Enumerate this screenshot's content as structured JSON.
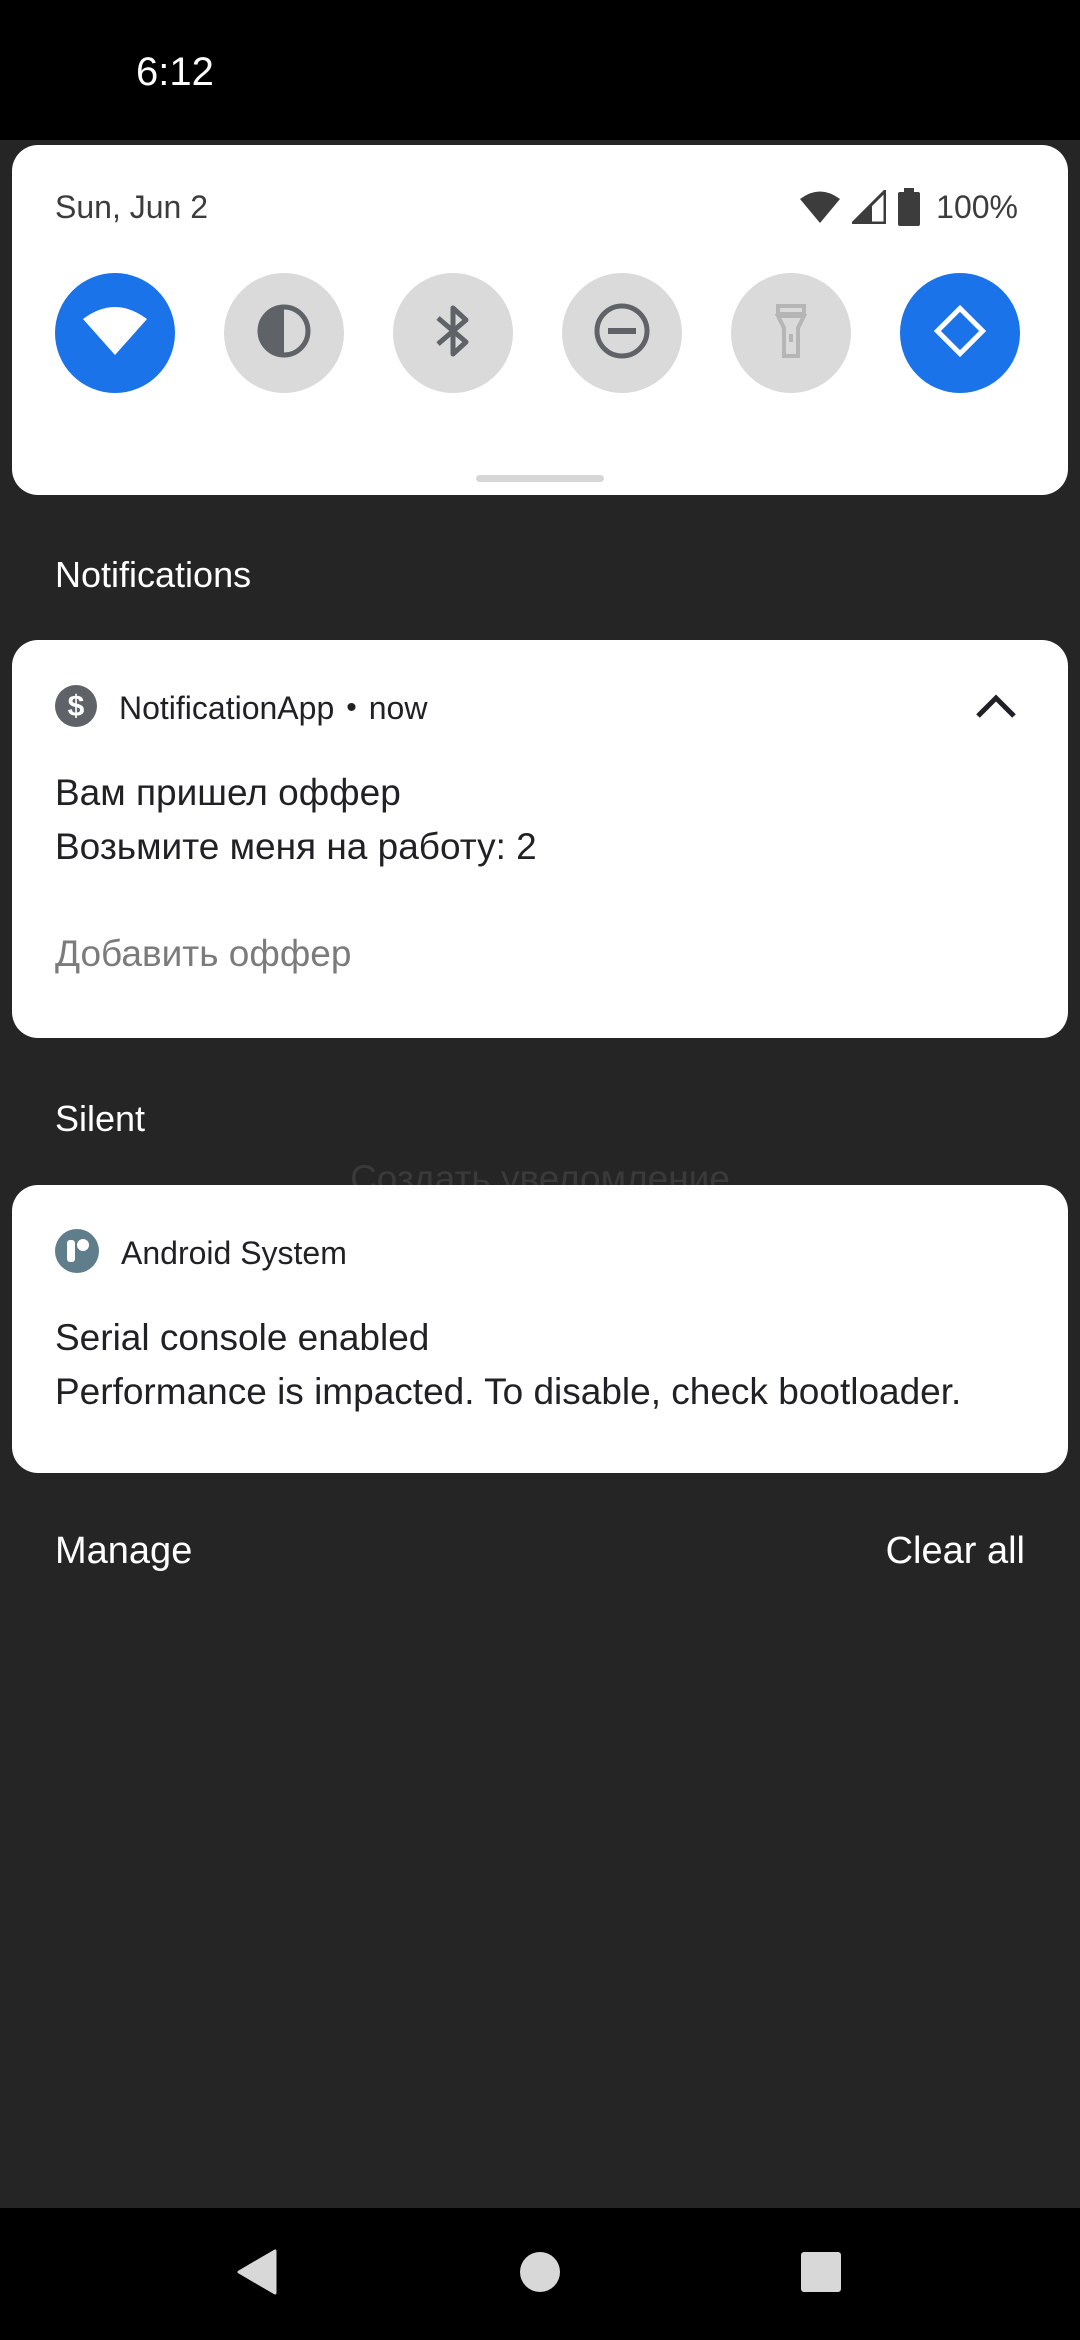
{
  "status_bar": {
    "time": "6:12"
  },
  "quick_settings": {
    "date": "Sun, Jun 2",
    "battery": "100%",
    "tiles": [
      {
        "name": "wifi",
        "state": "on"
      },
      {
        "name": "invert-colors",
        "state": "off"
      },
      {
        "name": "bluetooth",
        "state": "off"
      },
      {
        "name": "do-not-disturb",
        "state": "off"
      },
      {
        "name": "flashlight",
        "state": "off"
      },
      {
        "name": "auto-rotate",
        "state": "on"
      }
    ],
    "accent_color": "#1a73e8"
  },
  "notifications_section": {
    "header": "Notifications"
  },
  "notification_app": {
    "app_name": "NotificationApp",
    "separator": "•",
    "time": "now",
    "title": "Вам пришел оффер",
    "text": "Возьмите меня на работу: 2",
    "action": "Добавить оффер"
  },
  "silent_section": {
    "header": "Silent",
    "background_text": "Создать увеломление"
  },
  "system_notification": {
    "app_name": "Android System",
    "title": "Serial console enabled",
    "text": "Performance is impacted. To disable, check bootloader."
  },
  "footer": {
    "manage": "Manage",
    "clear_all": "Clear all"
  }
}
